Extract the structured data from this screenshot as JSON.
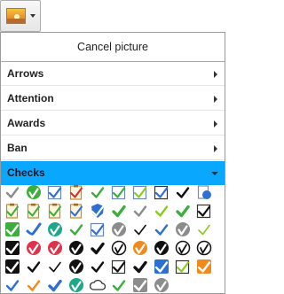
{
  "picture_button": {
    "icon": "picture-icon"
  },
  "menu": {
    "cancel_label": "Cancel picture",
    "categories": [
      {
        "label": "Arrows",
        "expanded": false
      },
      {
        "label": "Attention",
        "expanded": false
      },
      {
        "label": "Awards",
        "expanded": false
      },
      {
        "label": "Ban",
        "expanded": false
      },
      {
        "label": "Checks",
        "expanded": true
      }
    ]
  },
  "colors": {
    "accent": "#0aa7ff",
    "green": "#3cae3c",
    "dark": "#111111",
    "orange": "#f08a1c",
    "blue": "#2d6fd2"
  },
  "checks_icons": [
    [
      "plain-check-gray",
      "green-circle-check",
      "blue-box-check",
      "clipboard-check-red",
      "green-check",
      "green-box-check",
      "green-box-check-lime",
      "blue-outline-box-check",
      "black-check",
      "document-refresh-icon",
      "document-check-star"
    ],
    [
      "clipboard-check-orange",
      "clipboard-check-outline",
      "clipboard-check-list",
      "document-check-blue",
      "blue-shield-check",
      "green-check-bold",
      "silver-check",
      "lime-check",
      "green-check-heavy",
      "checkbox-outline"
    ],
    [
      "green-square-check",
      "blue-swoosh",
      "teal-circle-check",
      "green-check-tall",
      "blue-box-dark-check",
      "gray-sphere-check",
      "black-check-thin",
      "blue-check-glossy",
      "gray-circle-check",
      "lime-check-thin"
    ],
    [
      "black-square-check-alt",
      "pink-circle-check",
      "red-circle-check",
      "black-circle-check",
      "black-check-bold",
      "black-circle-check-outline",
      "orange-circle-check",
      "black-circle-check-white",
      "circle-check-outline",
      "circle-check-outline-bold"
    ],
    [
      "black-square-check",
      "black-check-outline",
      "black-check-thin-alt",
      "black-circle-check-solid",
      "white-check-outline",
      "box-check-outline",
      "black-check-heavy",
      "blue-square-check",
      "checkbox-lime-outline",
      "orange-square-check"
    ],
    [
      "blue-small-check",
      "orange-small-check",
      "blue-heavy-check",
      "teal-circle-check-alt",
      "cloud-check-outline",
      "green-small-check",
      "gray-square-check",
      "gray-circle-check-alt"
    ]
  ]
}
